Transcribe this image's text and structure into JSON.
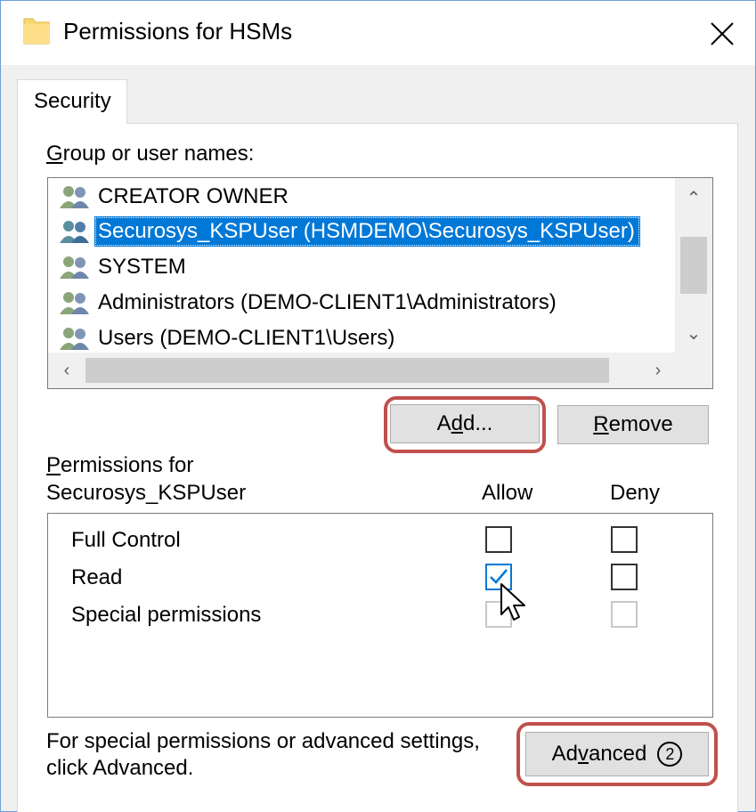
{
  "window": {
    "title": "Permissions for HSMs"
  },
  "tabs": [
    {
      "label": "Security"
    }
  ],
  "group_section": {
    "label_first": "G",
    "label_rest": "roup or user names:",
    "items": [
      {
        "name": "CREATOR OWNER",
        "selected": false
      },
      {
        "name": "Securosys_KSPUser (HSMDEMO\\Securosys_KSPUser)",
        "selected": true
      },
      {
        "name": "SYSTEM",
        "selected": false
      },
      {
        "name": "Administrators (DEMO-CLIENT1\\Administrators)",
        "selected": false
      },
      {
        "name": "Users (DEMO-CLIENT1\\Users)",
        "selected": false
      }
    ]
  },
  "buttons": {
    "add_pre": "A",
    "add_u": "d",
    "add_post": "d...",
    "remove_u": "R",
    "remove_post": "emove",
    "advanced_pre": "Ad",
    "advanced_u": "v",
    "advanced_post": "anced",
    "advanced_marker": "2"
  },
  "permissions": {
    "label_line1_u": "P",
    "label_line1_rest": "ermissions for",
    "label_line2": "Securosys_KSPUser",
    "allow_header": "Allow",
    "deny_header": "Deny",
    "rows": [
      {
        "name": "Full Control",
        "allow": "unchecked",
        "deny": "unchecked"
      },
      {
        "name": "Read",
        "allow": "checked",
        "deny": "unchecked"
      },
      {
        "name": "Special permissions",
        "allow": "disabled",
        "deny": "disabled"
      }
    ]
  },
  "footer_text": {
    "line1": "For special permissions or advanced settings,",
    "line2": "click Advanced."
  },
  "colors": {
    "selection": "#0078d7",
    "highlight_box": "#c0504d"
  }
}
